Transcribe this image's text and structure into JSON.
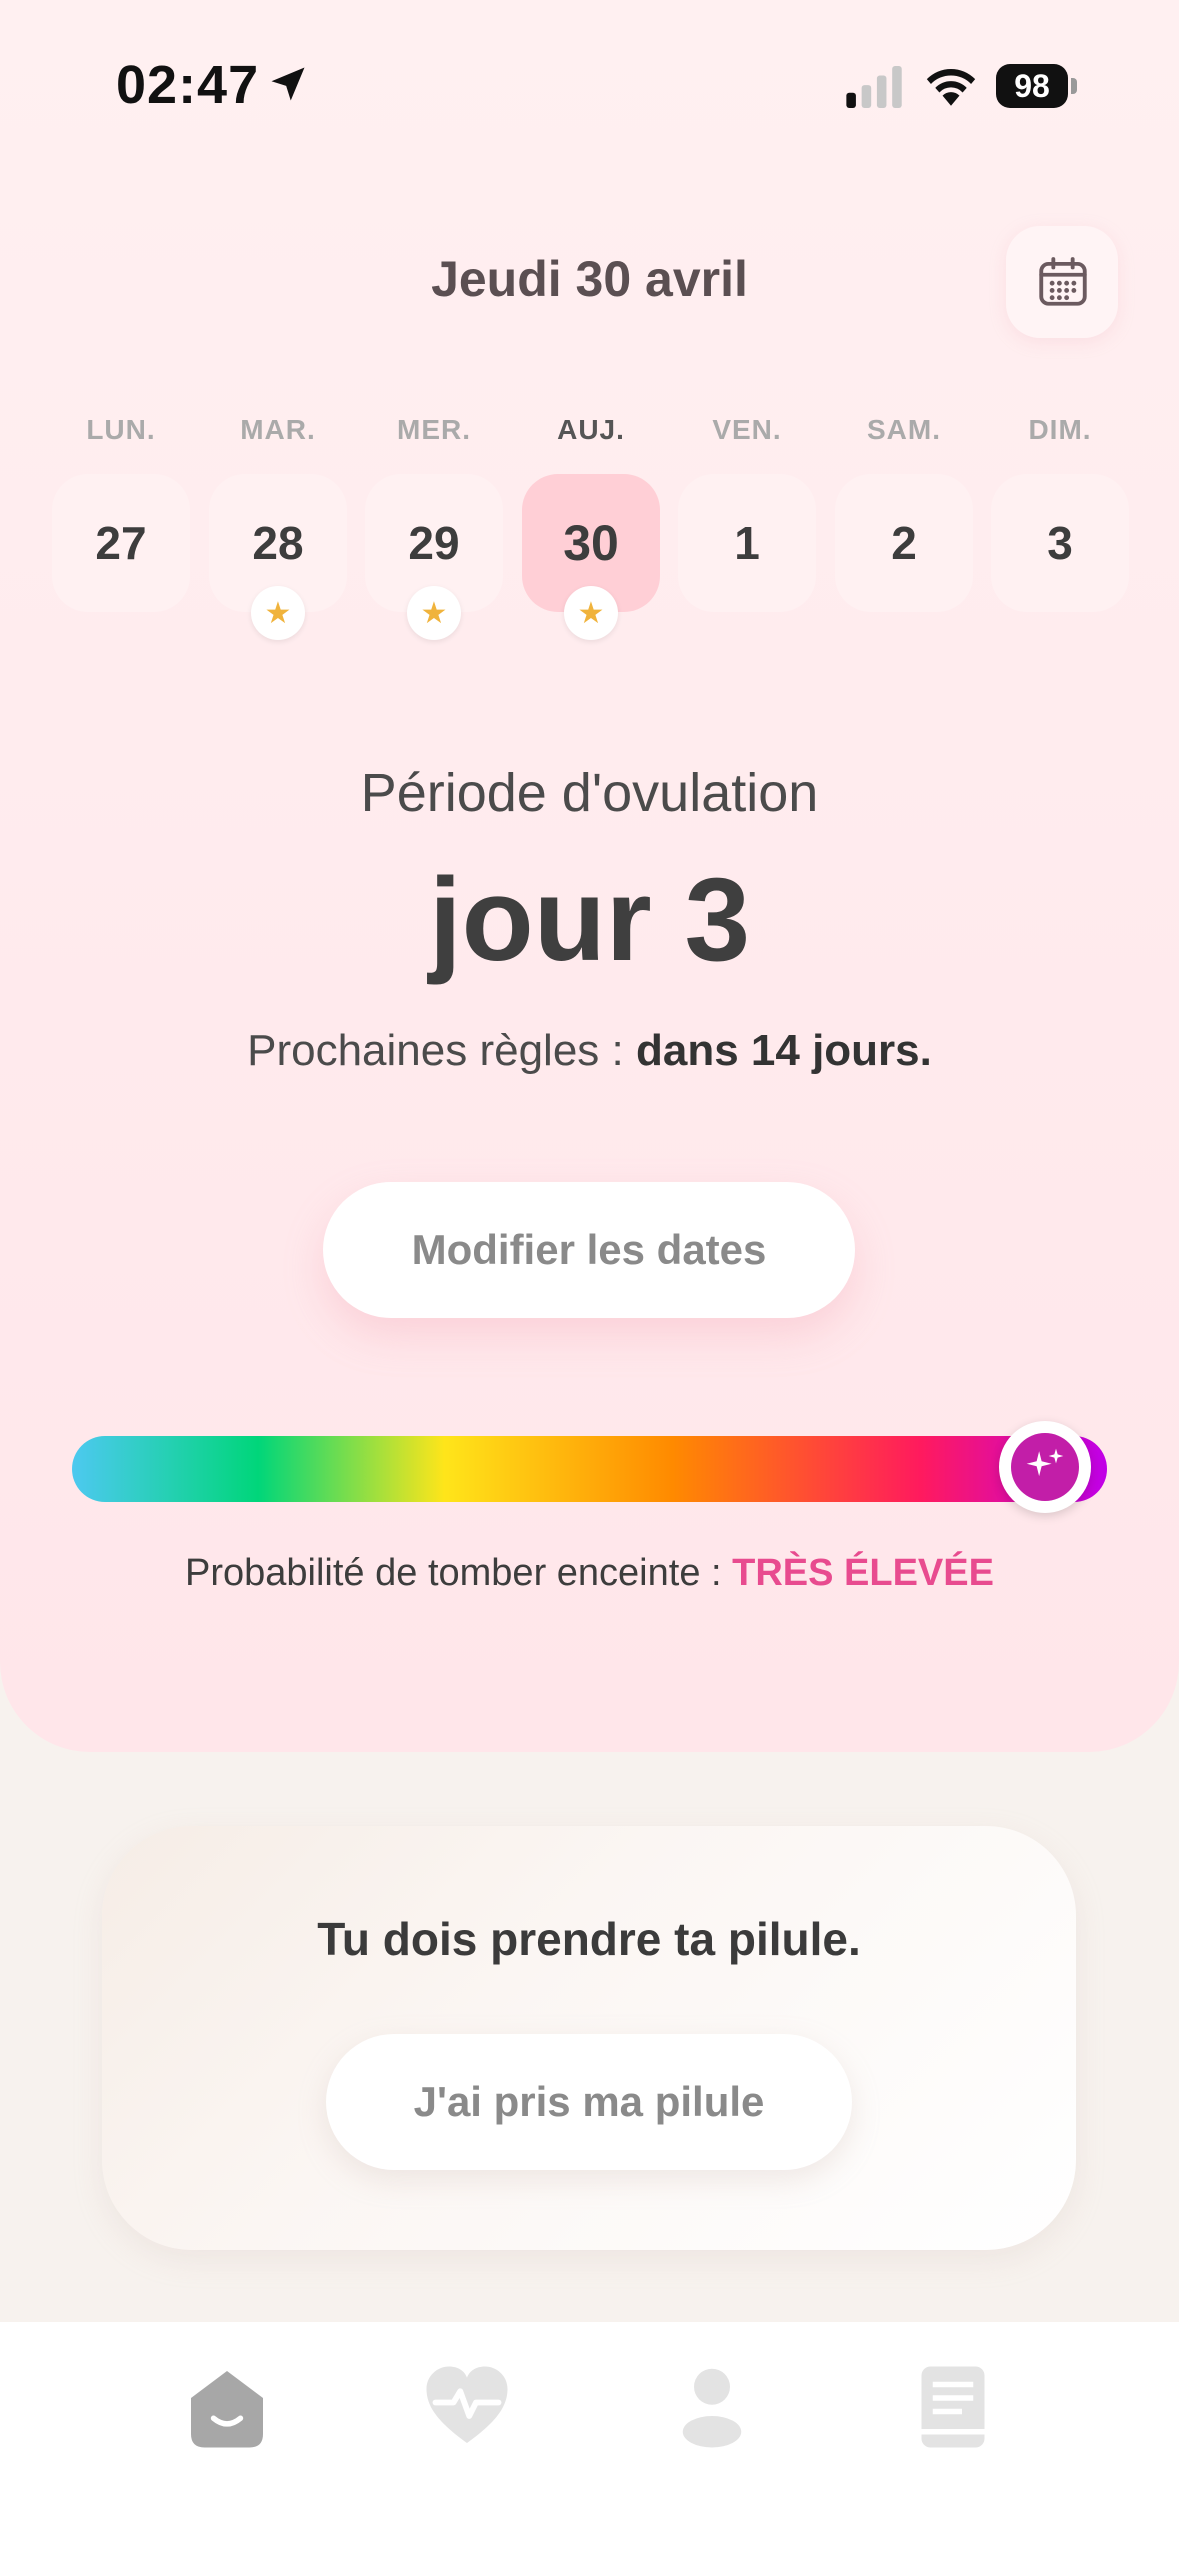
{
  "status_bar": {
    "time": "02:47",
    "battery": "98"
  },
  "header": {
    "date_title": "Jeudi 30 avril"
  },
  "week": [
    {
      "name": "LUN.",
      "num": "27",
      "star": false,
      "today": false
    },
    {
      "name": "MAR.",
      "num": "28",
      "star": true,
      "today": false
    },
    {
      "name": "MER.",
      "num": "29",
      "star": true,
      "today": false
    },
    {
      "name": "AUJ.",
      "num": "30",
      "star": true,
      "today": true
    },
    {
      "name": "VEN.",
      "num": "1",
      "star": false,
      "today": false
    },
    {
      "name": "SAM.",
      "num": "2",
      "star": false,
      "today": false
    },
    {
      "name": "DIM.",
      "num": "3",
      "star": false,
      "today": false
    }
  ],
  "cycle": {
    "phase": "Période d'ovulation",
    "day": "jour 3",
    "next_prefix": "Prochaines règles : ",
    "next_value": "dans 14 jours."
  },
  "buttons": {
    "modify": "Modifier les dates",
    "pill_taken": "J'ai pris ma pilule"
  },
  "probability": {
    "label": "Probabilité de tomber enceinte : ",
    "value": "TRÈS ÉLEVÉE",
    "level": 0.94
  },
  "pill_card": {
    "title": "Tu dois prendre ta pilule."
  },
  "tabbar": {
    "items": [
      "home-icon",
      "heart-pulse-icon",
      "profile-icon",
      "book-icon"
    ]
  },
  "colors": {
    "accent_pink": "#e84b8f",
    "knob_purple": "#c21ea8",
    "background": "#f7f2ee"
  }
}
